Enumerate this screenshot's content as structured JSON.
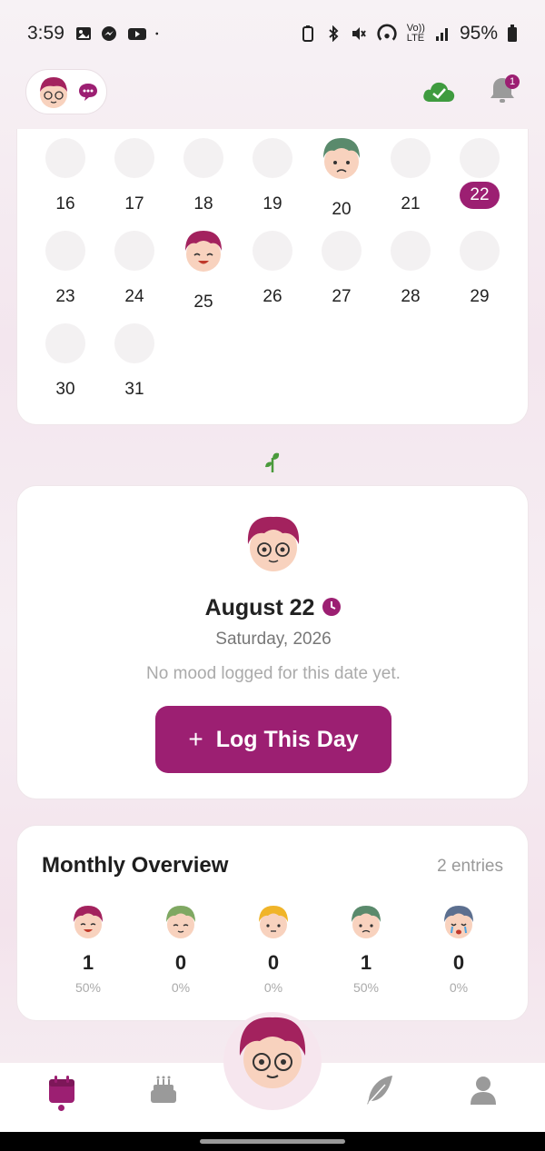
{
  "status_bar": {
    "time": "3:59",
    "battery": "95%",
    "network_1": "Vo))",
    "network_2": "LTE",
    "icons": [
      "image-icon",
      "messenger-icon",
      "youtube-icon",
      "dot-icon",
      "battery-saver-icon",
      "bluetooth-icon",
      "mute-icon",
      "hotspot-icon",
      "signal-icon",
      "battery-icon"
    ]
  },
  "header": {
    "notification_count": "1",
    "sync_icon": "cloud-check-icon",
    "colors": {
      "accent": "#9c1f72",
      "sync": "#3f9b3f"
    }
  },
  "calendar": {
    "selected_day": "22",
    "rows": [
      [
        "16",
        "17",
        "18",
        "19",
        "20",
        "21",
        "22"
      ],
      [
        "23",
        "24",
        "25",
        "26",
        "27",
        "28",
        "29"
      ],
      [
        "30",
        "31"
      ]
    ],
    "moods": {
      "20": "sad-green-face",
      "25": "happy-pink-face"
    }
  },
  "date_card": {
    "title": "August 22",
    "subtitle": "Saturday, 2026",
    "empty_text": "No mood logged for this date yet.",
    "button_label": "Log This Day",
    "button_icon": "+"
  },
  "overview": {
    "title": "Monthly Overview",
    "entries": "2 entries",
    "items": [
      {
        "face": "happy-pink-face",
        "count": "1",
        "percent": "50%"
      },
      {
        "face": "calm-green-face",
        "count": "0",
        "percent": "0%"
      },
      {
        "face": "neutral-yellow-face",
        "count": "0",
        "percent": "0%"
      },
      {
        "face": "sad-green-face",
        "count": "1",
        "percent": "50%"
      },
      {
        "face": "crying-blue-face",
        "count": "0",
        "percent": "0%"
      }
    ]
  },
  "bottom_nav": {
    "items": [
      "calendar-icon",
      "cake-icon",
      "mood-face-fab",
      "feather-icon",
      "profile-icon"
    ],
    "active": "calendar-icon"
  }
}
